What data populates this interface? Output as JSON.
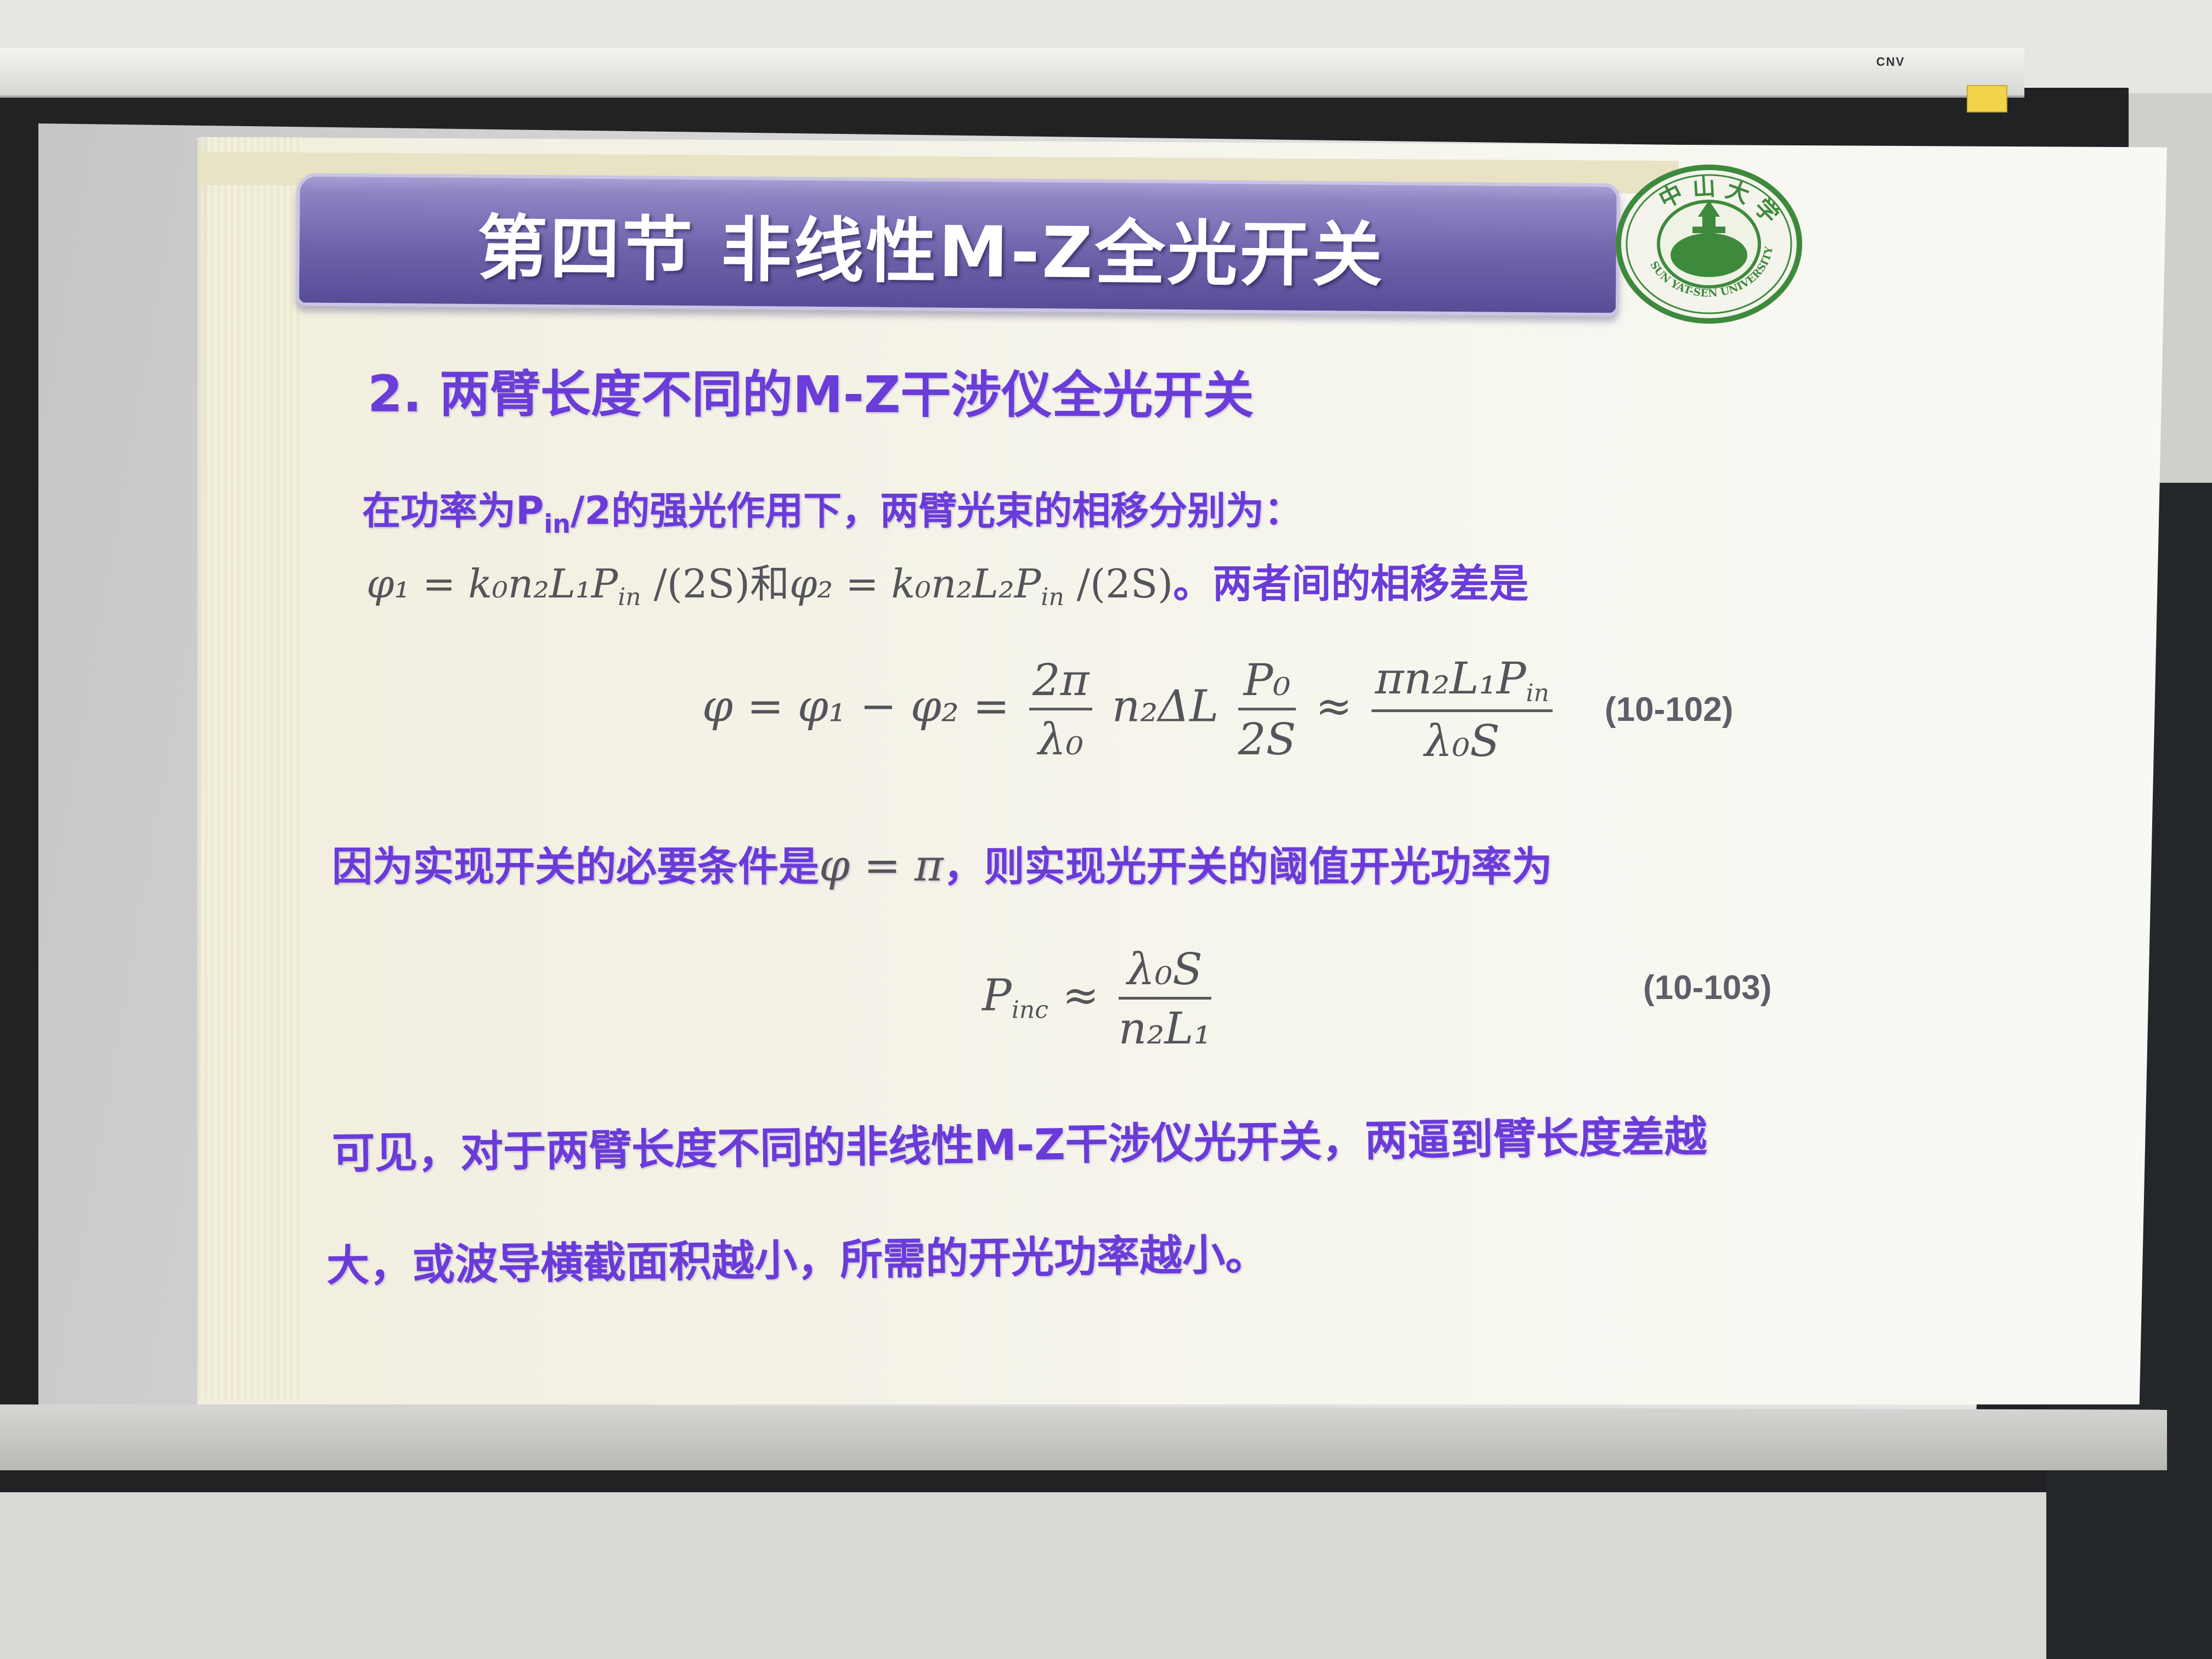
{
  "projector": {
    "brand": "CNV"
  },
  "slide": {
    "title": "第四节 非线性M-Z全光开关",
    "logo": {
      "name": "中山大学",
      "english": "SUN YAT-SEN UNIVERSITY"
    },
    "subheading": "2. 两臂长度不同的M-Z干涉仪全光开关",
    "intro": {
      "before": "在功率为P",
      "sub": "in",
      "after": "/2的强光作用下，两臂光束的相移分别为："
    },
    "phase_defs": {
      "part1": "φ₁ = k₀n₂L₁P",
      "part1_sub": "in",
      "part1_end": " /(2S)",
      "conj": "和",
      "part2": "φ₂ = k₀n₂L₂P",
      "part2_sub": "in",
      "part2_end": " /(2S)",
      "tail": "。两者间的相移差是"
    },
    "eq1": {
      "lhs": "φ = φ₁ − φ₂ =",
      "frac1_num": "2π",
      "frac1_den": "λ₀",
      "mid": "n₂ΔL",
      "frac2_num": "P₀",
      "frac2_den": "2S",
      "approx": "≈",
      "frac3_num": "πn₂L₁P",
      "frac3_num_sub": "in",
      "frac3_den": "λ₀S",
      "number": "(10-102)"
    },
    "condition": {
      "before": "因为实现开关的必要条件是",
      "math": "φ = π",
      "after": "，则实现光开关的阈值开光功率为"
    },
    "eq2": {
      "lhs": "P",
      "lhs_sub": "inc",
      "approx": "≈",
      "num": "λ₀S",
      "den": "n₂L₁",
      "number": "(10-103)"
    },
    "conclusion_line1": "可见，对于两臂长度不同的非线性M-Z干涉仪光开关，两逼到臂长度差越",
    "conclusion_line2": "大，或波导横截面积越小，所需的开光功率越小。"
  },
  "colors": {
    "title_bar": "#6f64ab",
    "body_text": "#6a3bd9",
    "math_text": "#55545a",
    "logo_green": "#3e8a3c"
  }
}
